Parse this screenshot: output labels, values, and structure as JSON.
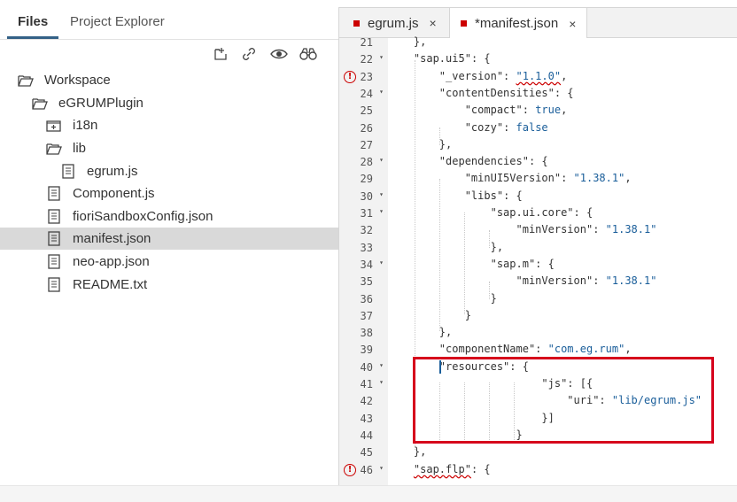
{
  "left_panel": {
    "tabs": [
      {
        "label": "Files",
        "active": true
      },
      {
        "label": "Project Explorer",
        "active": false
      }
    ],
    "tools": [
      "new-folder-icon",
      "link-icon",
      "eye-icon",
      "binoculars-icon"
    ],
    "tree": [
      {
        "label": "Workspace",
        "icon": "folder-open-icon",
        "depth": 0
      },
      {
        "label": "eGRUMPlugin",
        "icon": "folder-open-icon",
        "depth": 1
      },
      {
        "label": "i18n",
        "icon": "folder-closed-icon",
        "depth": 2
      },
      {
        "label": "lib",
        "icon": "folder-open-icon",
        "depth": 2
      },
      {
        "label": "egrum.js",
        "icon": "file-icon",
        "depth": 3
      },
      {
        "label": "Component.js",
        "icon": "file-icon",
        "depth": 2
      },
      {
        "label": "fioriSandboxConfig.json",
        "icon": "file-icon",
        "depth": 2
      },
      {
        "label": "manifest.json",
        "icon": "file-icon",
        "depth": 2,
        "selected": true
      },
      {
        "label": "neo-app.json",
        "icon": "file-icon",
        "depth": 2
      },
      {
        "label": "README.txt",
        "icon": "file-icon",
        "depth": 2
      }
    ]
  },
  "editor": {
    "tabs": [
      {
        "label": "egrum.js",
        "close": "×",
        "active": false
      },
      {
        "label": "*manifest.json",
        "close": "×",
        "active": true
      }
    ],
    "lines": [
      {
        "n": "21",
        "fold": false,
        "err": false,
        "text": "    },"
      },
      {
        "n": "22",
        "fold": true,
        "err": false,
        "text": "    \"sap.ui5\": {"
      },
      {
        "n": "23",
        "fold": false,
        "err": true,
        "text": "        \"_version\": \"1.1.0\","
      },
      {
        "n": "24",
        "fold": true,
        "err": false,
        "text": "        \"contentDensities\": {"
      },
      {
        "n": "25",
        "fold": false,
        "err": false,
        "text": "            \"compact\": true,"
      },
      {
        "n": "26",
        "fold": false,
        "err": false,
        "text": "            \"cozy\": false"
      },
      {
        "n": "27",
        "fold": false,
        "err": false,
        "text": "        },"
      },
      {
        "n": "28",
        "fold": true,
        "err": false,
        "text": "        \"dependencies\": {"
      },
      {
        "n": "29",
        "fold": false,
        "err": false,
        "text": "            \"minUI5Version\": \"1.38.1\","
      },
      {
        "n": "30",
        "fold": true,
        "err": false,
        "text": "            \"libs\": {"
      },
      {
        "n": "31",
        "fold": true,
        "err": false,
        "text": "                \"sap.ui.core\": {"
      },
      {
        "n": "32",
        "fold": false,
        "err": false,
        "text": "                    \"minVersion\": \"1.38.1\""
      },
      {
        "n": "33",
        "fold": false,
        "err": false,
        "text": "                },"
      },
      {
        "n": "34",
        "fold": true,
        "err": false,
        "text": "                \"sap.m\": {"
      },
      {
        "n": "35",
        "fold": false,
        "err": false,
        "text": "                    \"minVersion\": \"1.38.1\""
      },
      {
        "n": "36",
        "fold": false,
        "err": false,
        "text": "                }"
      },
      {
        "n": "37",
        "fold": false,
        "err": false,
        "text": "            }"
      },
      {
        "n": "38",
        "fold": false,
        "err": false,
        "text": "        },"
      },
      {
        "n": "39",
        "fold": false,
        "err": false,
        "text": "        \"componentName\": \"com.eg.rum\","
      },
      {
        "n": "40",
        "fold": true,
        "err": false,
        "text": "        \"resources\": {"
      },
      {
        "n": "41",
        "fold": true,
        "err": false,
        "text": "                        \"js\": [{"
      },
      {
        "n": "42",
        "fold": false,
        "err": false,
        "text": "                            \"uri\": \"lib/egrum.js\""
      },
      {
        "n": "43",
        "fold": false,
        "err": false,
        "text": "                        }]"
      },
      {
        "n": "44",
        "fold": false,
        "err": false,
        "text": "                    }"
      },
      {
        "n": "45",
        "fold": false,
        "err": false,
        "text": "    },"
      },
      {
        "n": "46",
        "fold": true,
        "err": true,
        "text": "    \"sap.flp\": {"
      }
    ],
    "error_mark": "!",
    "fold_mark": "▾"
  },
  "colors": {
    "accent": "#346187",
    "error": "#cc0000",
    "highlight_box": "#d6001c",
    "string": "#1a5e9a"
  }
}
